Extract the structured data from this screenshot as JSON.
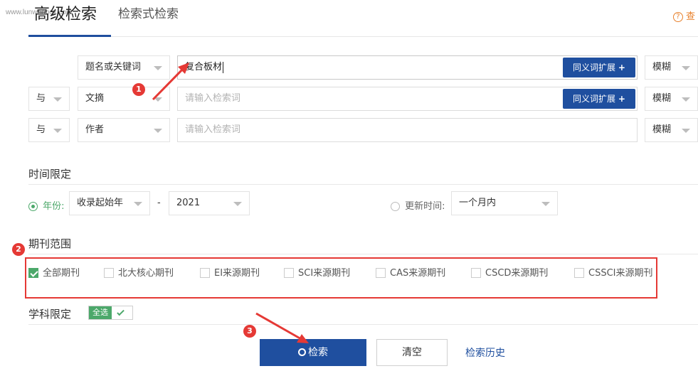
{
  "watermark": "www.lunwenbox.com",
  "tabs": {
    "active": "高级检索",
    "other": "检索式检索"
  },
  "help": {
    "icon_char": "?",
    "text": "查"
  },
  "rows": [
    {
      "logic": "",
      "field": "题名或关键词",
      "value": "复合板材",
      "placeholder": "",
      "synonym_button": "同义词扩展",
      "match": "模糊"
    },
    {
      "logic": "与",
      "field": "文摘",
      "value": "",
      "placeholder": "请输入检索词",
      "synonym_button": "同义词扩展",
      "match": "模糊"
    },
    {
      "logic": "与",
      "field": "作者",
      "value": "",
      "placeholder": "请输入检索词",
      "synonym_button": "",
      "match": "模糊"
    }
  ],
  "time": {
    "title": "时间限定",
    "year_label": "年份:",
    "start_year": "收录起始年",
    "separator": "-",
    "end_year": "2021",
    "update_label": "更新时间:",
    "update_value": "一个月内",
    "selected": "year"
  },
  "journal": {
    "title": "期刊范围",
    "options": [
      {
        "label": "全部期刊",
        "checked": true
      },
      {
        "label": "北大核心期刊",
        "checked": false
      },
      {
        "label": "EI来源期刊",
        "checked": false
      },
      {
        "label": "SCI来源期刊",
        "checked": false
      },
      {
        "label": "CAS来源期刊",
        "checked": false
      },
      {
        "label": "CSCD来源期刊",
        "checked": false
      },
      {
        "label": "CSSCI来源期刊",
        "checked": false
      }
    ]
  },
  "subject": {
    "title": "学科限定",
    "all_label": "全选"
  },
  "actions": {
    "search": "检索",
    "clear": "清空",
    "history": "检索历史"
  },
  "annotations": [
    "1",
    "2",
    "3"
  ],
  "colors": {
    "primary": "#1f4f9f",
    "accent_green": "#4ca86a",
    "annotation_red": "#e53935"
  }
}
